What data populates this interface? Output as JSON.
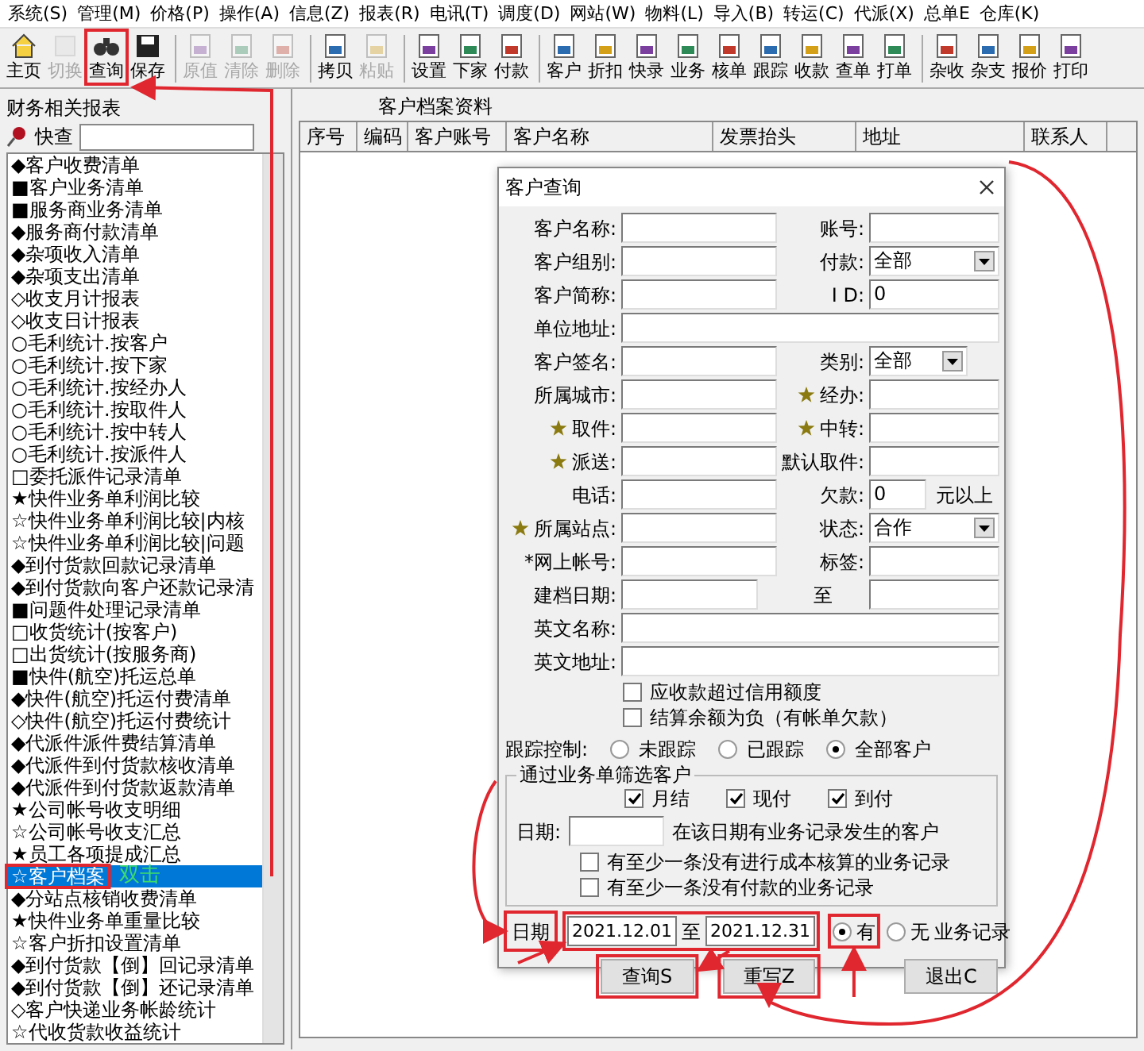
{
  "menu": [
    "系统(S)",
    "管理(M)",
    "价格(P)",
    "操作(A)",
    "信息(Z)",
    "报表(R)",
    "电讯(T)",
    "调度(D)",
    "网站(W)",
    "物料(L)",
    "导入(B)",
    "转运(C)",
    "代派(X)",
    "总单E",
    "仓库(K)"
  ],
  "toolbar": [
    {
      "label": "主页",
      "disabled": false,
      "separator_after": false
    },
    {
      "label": "切换",
      "disabled": true,
      "separator_after": false
    },
    {
      "label": "查询",
      "disabled": false,
      "separator_after": false
    },
    {
      "label": "保存",
      "disabled": false,
      "separator_after": true
    },
    {
      "label": "原值",
      "disabled": true,
      "separator_after": false
    },
    {
      "label": "清除",
      "disabled": true,
      "separator_after": false
    },
    {
      "label": "删除",
      "disabled": true,
      "separator_after": true
    },
    {
      "label": "拷贝",
      "disabled": false,
      "separator_after": false
    },
    {
      "label": "粘贴",
      "disabled": true,
      "separator_after": true
    },
    {
      "label": "设置",
      "disabled": false,
      "separator_after": false
    },
    {
      "label": "下家",
      "disabled": false,
      "separator_after": false
    },
    {
      "label": "付款",
      "disabled": false,
      "separator_after": true
    },
    {
      "label": "客户",
      "disabled": false,
      "separator_after": false
    },
    {
      "label": "折扣",
      "disabled": false,
      "separator_after": false
    },
    {
      "label": "快录",
      "disabled": false,
      "separator_after": false
    },
    {
      "label": "业务",
      "disabled": false,
      "separator_after": false
    },
    {
      "label": "核单",
      "disabled": false,
      "separator_after": false
    },
    {
      "label": "跟踪",
      "disabled": false,
      "separator_after": false
    },
    {
      "label": "收款",
      "disabled": false,
      "separator_after": false
    },
    {
      "label": "查单",
      "disabled": false,
      "separator_after": false
    },
    {
      "label": "打单",
      "disabled": false,
      "separator_after": true
    },
    {
      "label": "杂收",
      "disabled": false,
      "separator_after": false
    },
    {
      "label": "杂支",
      "disabled": false,
      "separator_after": false
    },
    {
      "label": "报价",
      "disabled": false,
      "separator_after": false
    },
    {
      "label": "打印",
      "disabled": false,
      "separator_after": false
    }
  ],
  "left_panel": {
    "title": "财务相关报表",
    "quick_search_label": "快查",
    "items": [
      {
        "text": "◆客户收费清单",
        "selected": false
      },
      {
        "text": "■客户业务清单",
        "selected": false
      },
      {
        "text": "■服务商业务清单",
        "selected": false
      },
      {
        "text": "◆服务商付款清单",
        "selected": false
      },
      {
        "text": "◆杂项收入清单",
        "selected": false
      },
      {
        "text": "◆杂项支出清单",
        "selected": false
      },
      {
        "text": "◇收支月计报表",
        "selected": false
      },
      {
        "text": "◇收支日计报表",
        "selected": false
      },
      {
        "text": "○毛利统计.按客户",
        "selected": false
      },
      {
        "text": "○毛利统计.按下家",
        "selected": false
      },
      {
        "text": "○毛利统计.按经办人",
        "selected": false
      },
      {
        "text": "○毛利统计.按取件人",
        "selected": false
      },
      {
        "text": "○毛利统计.按中转人",
        "selected": false
      },
      {
        "text": "○毛利统计.按派件人",
        "selected": false
      },
      {
        "text": "□委托派件记录清单",
        "selected": false
      },
      {
        "text": "★快件业务单利润比较",
        "selected": false
      },
      {
        "text": "☆快件业务单利润比较|内核",
        "selected": false
      },
      {
        "text": "☆快件业务单利润比较|问题",
        "selected": false
      },
      {
        "text": "◆到付货款回款记录清单",
        "selected": false
      },
      {
        "text": "◆到付货款向客户还款记录清",
        "selected": false
      },
      {
        "text": "■问题件处理记录清单",
        "selected": false
      },
      {
        "text": "□收货统计(按客户)",
        "selected": false
      },
      {
        "text": "□出货统计(按服务商)",
        "selected": false
      },
      {
        "text": "■快件(航空)托运总单",
        "selected": false
      },
      {
        "text": "◆快件(航空)托运付费清单",
        "selected": false
      },
      {
        "text": "◇快件(航空)托运付费统计",
        "selected": false
      },
      {
        "text": "◆代派件派件费结算清单",
        "selected": false
      },
      {
        "text": "◆代派件到付货款核收清单",
        "selected": false
      },
      {
        "text": "◆代派件到付货款返款清单",
        "selected": false
      },
      {
        "text": "★公司帐号收支明细",
        "selected": false
      },
      {
        "text": "☆公司帐号收支汇总",
        "selected": false
      },
      {
        "text": "★员工各项提成汇总",
        "selected": false
      },
      {
        "text": "☆客户档案",
        "selected": true
      },
      {
        "text": "◆分站点核销收费清单",
        "selected": false
      },
      {
        "text": "★快件业务单重量比较",
        "selected": false
      },
      {
        "text": "☆客户折扣设置清单",
        "selected": false
      },
      {
        "text": "◆到付货款【倒】回记录清单",
        "selected": false
      },
      {
        "text": "◆到付货款【倒】还记录清单",
        "selected": false
      },
      {
        "text": "◇客户快递业务帐龄统计",
        "selected": false
      },
      {
        "text": "☆代收货款收益统计",
        "selected": false
      }
    ]
  },
  "right_panel": {
    "title": "客户档案资料",
    "columns": [
      "序号",
      "编码",
      "客户账号",
      "客户名称",
      "发票抬头",
      "地址",
      "联系人"
    ]
  },
  "dialog": {
    "title": "客户查询",
    "rows": [
      {
        "kind": "pair",
        "left": {
          "label": "客户名称:",
          "kind": "text"
        },
        "right": {
          "label": "账号:",
          "kind": "text"
        }
      },
      {
        "kind": "pair",
        "left": {
          "label": "客户组别:",
          "kind": "text"
        },
        "right": {
          "label": "付款:",
          "kind": "select",
          "value": "全部"
        }
      },
      {
        "kind": "pair",
        "left": {
          "label": "客户简称:",
          "kind": "text"
        },
        "right": {
          "label": "I D:",
          "kind": "text",
          "value": "0"
        }
      },
      {
        "kind": "wide",
        "label": "单位地址:"
      },
      {
        "kind": "pair",
        "left": {
          "label": "客户签名:",
          "kind": "text"
        },
        "right": {
          "label": "类别:",
          "kind": "combo",
          "value": "全部"
        }
      },
      {
        "kind": "pair",
        "left": {
          "label": "所属城市:",
          "kind": "text"
        },
        "right": {
          "label": "经办:",
          "kind": "text",
          "starred": true
        }
      },
      {
        "kind": "pair",
        "left": {
          "label": "取件:",
          "kind": "text",
          "starred": true
        },
        "right": {
          "label": "中转:",
          "kind": "text",
          "starred": true
        }
      },
      {
        "kind": "pair",
        "left": {
          "label": "派送:",
          "kind": "text",
          "starred": true
        },
        "right": {
          "label": "默认取件:",
          "kind": "text"
        }
      },
      {
        "kind": "pair",
        "left": {
          "label": "电话:",
          "kind": "text"
        },
        "right": {
          "label": "欠款:",
          "kind": "number",
          "value": "0",
          "suffix": "元以上"
        }
      },
      {
        "kind": "pair",
        "left": {
          "label": "所属站点:",
          "kind": "text",
          "starred": true
        },
        "right": {
          "label": "状态:",
          "kind": "select",
          "value": "合作"
        }
      },
      {
        "kind": "pair",
        "left": {
          "label": "*网上帐号:",
          "kind": "text"
        },
        "right": {
          "label": "标签:",
          "kind": "text"
        }
      },
      {
        "kind": "pair",
        "left": {
          "label": "建档日期:",
          "kind": "short"
        },
        "right": {
          "label": "至",
          "kind": "text"
        }
      },
      {
        "kind": "wide",
        "label": "英文名称:"
      },
      {
        "kind": "wide",
        "label": "英文地址:"
      }
    ],
    "checks": [
      {
        "label": "应收款超过信用额度",
        "checked": false
      },
      {
        "label": "结算余额为负（有帐单欠款）",
        "checked": false
      }
    ],
    "tracking": {
      "label": "跟踪控制:",
      "options": [
        {
          "label": "未跟踪",
          "selected": false
        },
        {
          "label": "已跟踪",
          "selected": false
        },
        {
          "label": "全部客户",
          "selected": true
        }
      ]
    },
    "filter_group": {
      "title": "通过业务单筛选客户",
      "checks": [
        {
          "label": "月结",
          "checked": true
        },
        {
          "label": "现付",
          "checked": true
        },
        {
          "label": "到付",
          "checked": true
        }
      ],
      "date_label": "日期:",
      "date_note": "在该日期有业务记录发生的客户",
      "options": [
        {
          "label": "有至少一条没有进行成本核算的业务记录",
          "checked": false
        },
        {
          "label": "有至少一条没有付款的业务记录",
          "checked": false
        }
      ]
    },
    "date_row": {
      "label": "日期",
      "from": "2021.12.01",
      "separator": "至",
      "to": "2021.12.31",
      "options": [
        {
          "label": "有",
          "selected": true
        },
        {
          "label": "无",
          "selected": false
        }
      ],
      "suffix": "业务记录"
    },
    "buttons": [
      "查询S",
      "重写Z",
      "退出C"
    ]
  },
  "annotation": {
    "note": "双击"
  }
}
